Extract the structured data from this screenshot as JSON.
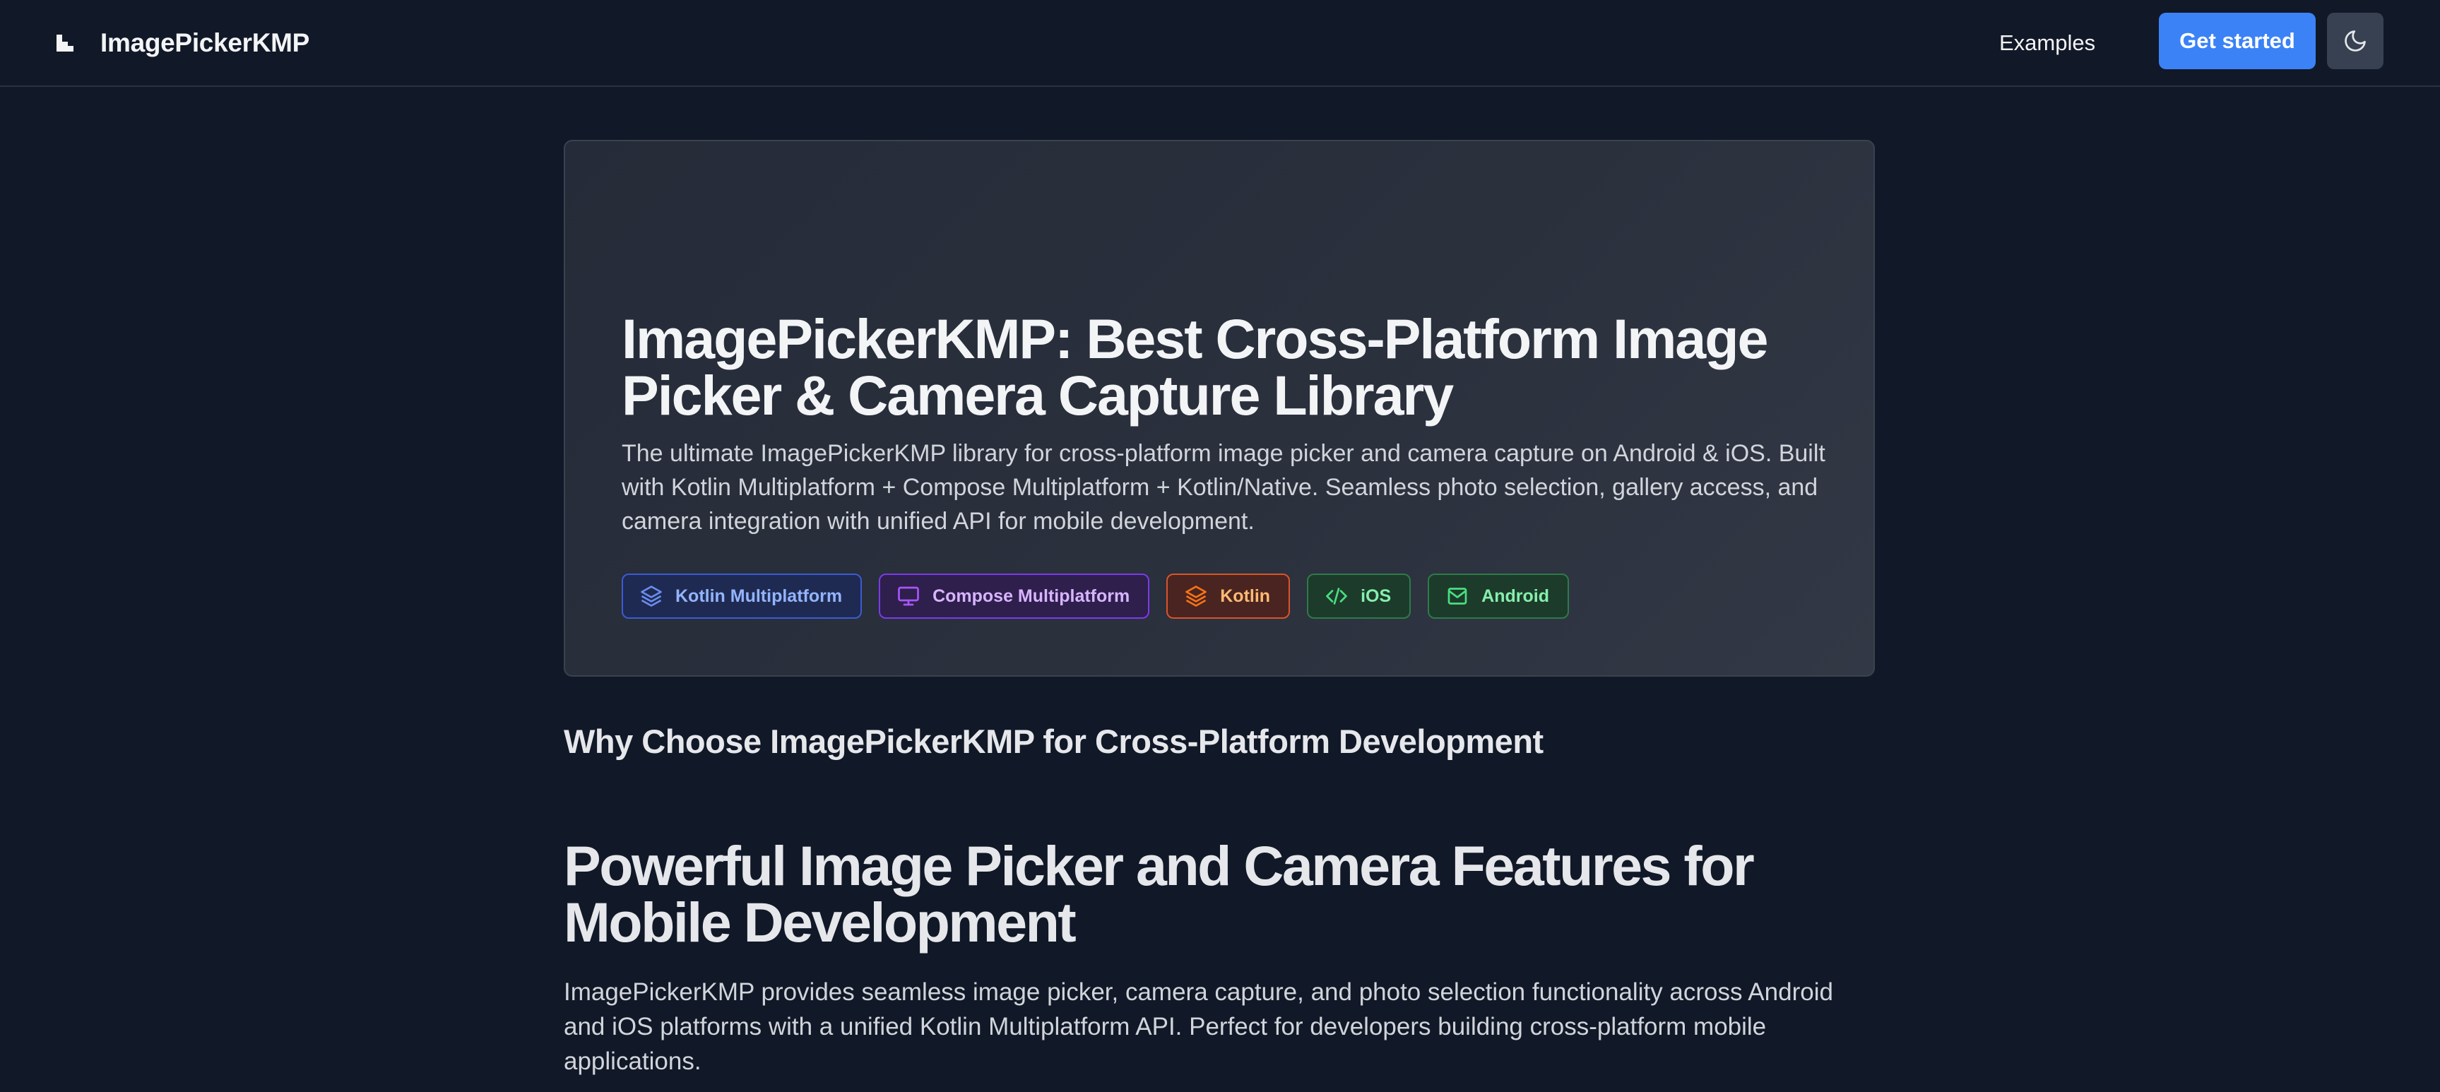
{
  "header": {
    "brand_name": "ImagePickerKMP",
    "nav": {
      "examples_label": "Examples"
    },
    "get_started_label": "Get started",
    "theme_toggle_icon": "moon-icon"
  },
  "hero": {
    "title": "ImagePickerKMP: Best Cross-Platform Image Picker & Camera Capture Library",
    "description": "The ultimate ImagePickerKMP library for cross-platform image picker and camera capture on Android & iOS. Built with Kotlin Multiplatform + Compose Multiplatform + Kotlin/Native. Seamless photo selection, gallery access, and camera integration with unified API for mobile development.",
    "tags": [
      {
        "label": "Kotlin Multiplatform",
        "icon": "layers-icon",
        "color": "#93b4fd"
      },
      {
        "label": "Compose Multiplatform",
        "icon": "monitor-icon",
        "color": "#d8b4fe"
      },
      {
        "label": "Kotlin",
        "icon": "layers-icon",
        "color": "#fdba74"
      },
      {
        "label": "iOS",
        "icon": "code-icon",
        "color": "#86efac"
      },
      {
        "label": "Android",
        "icon": "mail-icon",
        "color": "#86efac"
      }
    ]
  },
  "why_section": {
    "heading": "Why Choose ImagePickerKMP for Cross-Platform Development"
  },
  "features": {
    "title": "Powerful Image Picker and Camera Features for Mobile Development",
    "description": "ImagePickerKMP provides seamless image picker, camera capture, and photo selection functionality across Android and iOS platforms with a unified Kotlin Multiplatform API. Perfect for developers building cross-platform mobile applications."
  },
  "colors": {
    "background": "#111827",
    "accent": "#3b82f6",
    "card": "#2a303c"
  }
}
